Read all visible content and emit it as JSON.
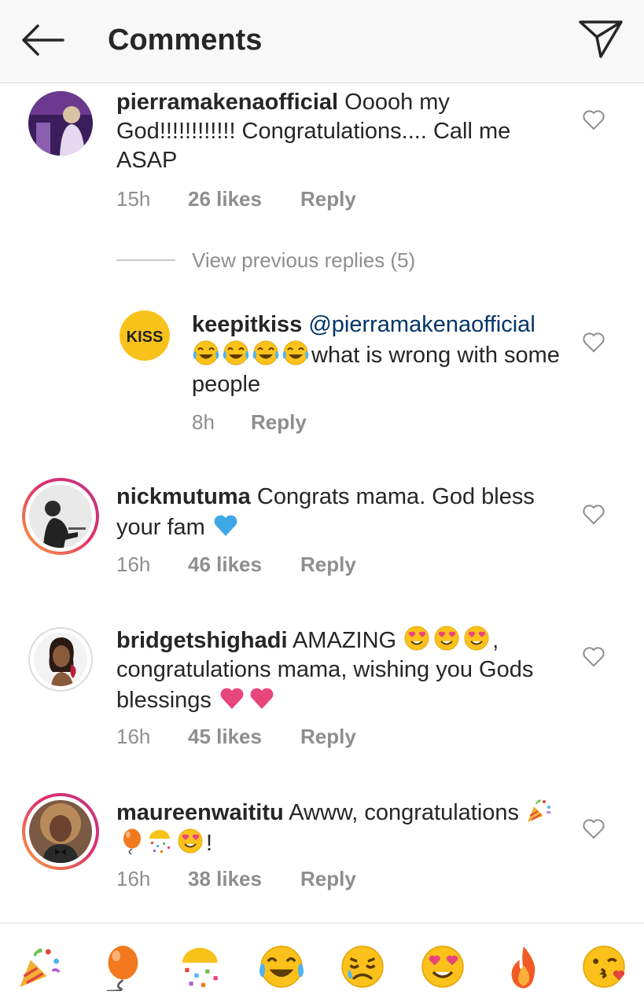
{
  "header": {
    "title": "Comments",
    "back_icon": "back-arrow-icon",
    "send_icon": "direct-send-icon"
  },
  "comments": [
    {
      "username": "pierramakenaofficial",
      "text": "Ooooh my God!!!!!!!!!!!! Congratulations.... Call me ASAP",
      "time": "15h",
      "likes": "26 likes",
      "reply": "Reply"
    },
    {
      "username": "keepitkiss",
      "mention": "@pierramakenaofficial",
      "emojis": [
        "tears-of-joy",
        "tears-of-joy",
        "tears-of-joy",
        "tears-of-joy"
      ],
      "text_line1_extra": "what is wrong",
      "text_line2": "with some people",
      "time": "8h",
      "reply": "Reply",
      "avatar_text": "KISS"
    },
    {
      "username": "nickmutuma",
      "text": "Congrats mama. God bless your fam",
      "emojis": [
        "blue-heart"
      ],
      "time": "16h",
      "likes": "46 likes",
      "reply": "Reply"
    },
    {
      "username": "bridgetshighadi",
      "text_start": "AMAZING",
      "emojis_a": [
        "heart-eyes",
        "heart-eyes",
        "heart-eyes"
      ],
      "text_mid": ", congratulations mama, wishing you Gods blessings",
      "emojis_b": [
        "pink-heart",
        "pink-heart"
      ],
      "time": "16h",
      "likes": "45 likes",
      "reply": "Reply"
    },
    {
      "username": "maureenwaititu",
      "text": "Awww,  congratulations",
      "emojis": [
        "party-popper",
        "balloon",
        "confetti-ball",
        "heart-eyes"
      ],
      "text_end": "!",
      "time": "16h",
      "likes": "38 likes",
      "reply": "Reply"
    }
  ],
  "view_previous": "View previous replies (5)",
  "emoji_bar": [
    "party-popper",
    "balloon",
    "confetti-ball",
    "tears-of-joy",
    "disappointed-relieved",
    "heart-eyes",
    "fire",
    "kissing-heart"
  ],
  "colors": {
    "accent_ring": "#e1306c",
    "mention": "#003569",
    "meta": "#8e8e8e",
    "blue_heart": "#3ea8e6",
    "pink_heart": "#e8457a",
    "kiss_bg": "#f7c21a"
  }
}
